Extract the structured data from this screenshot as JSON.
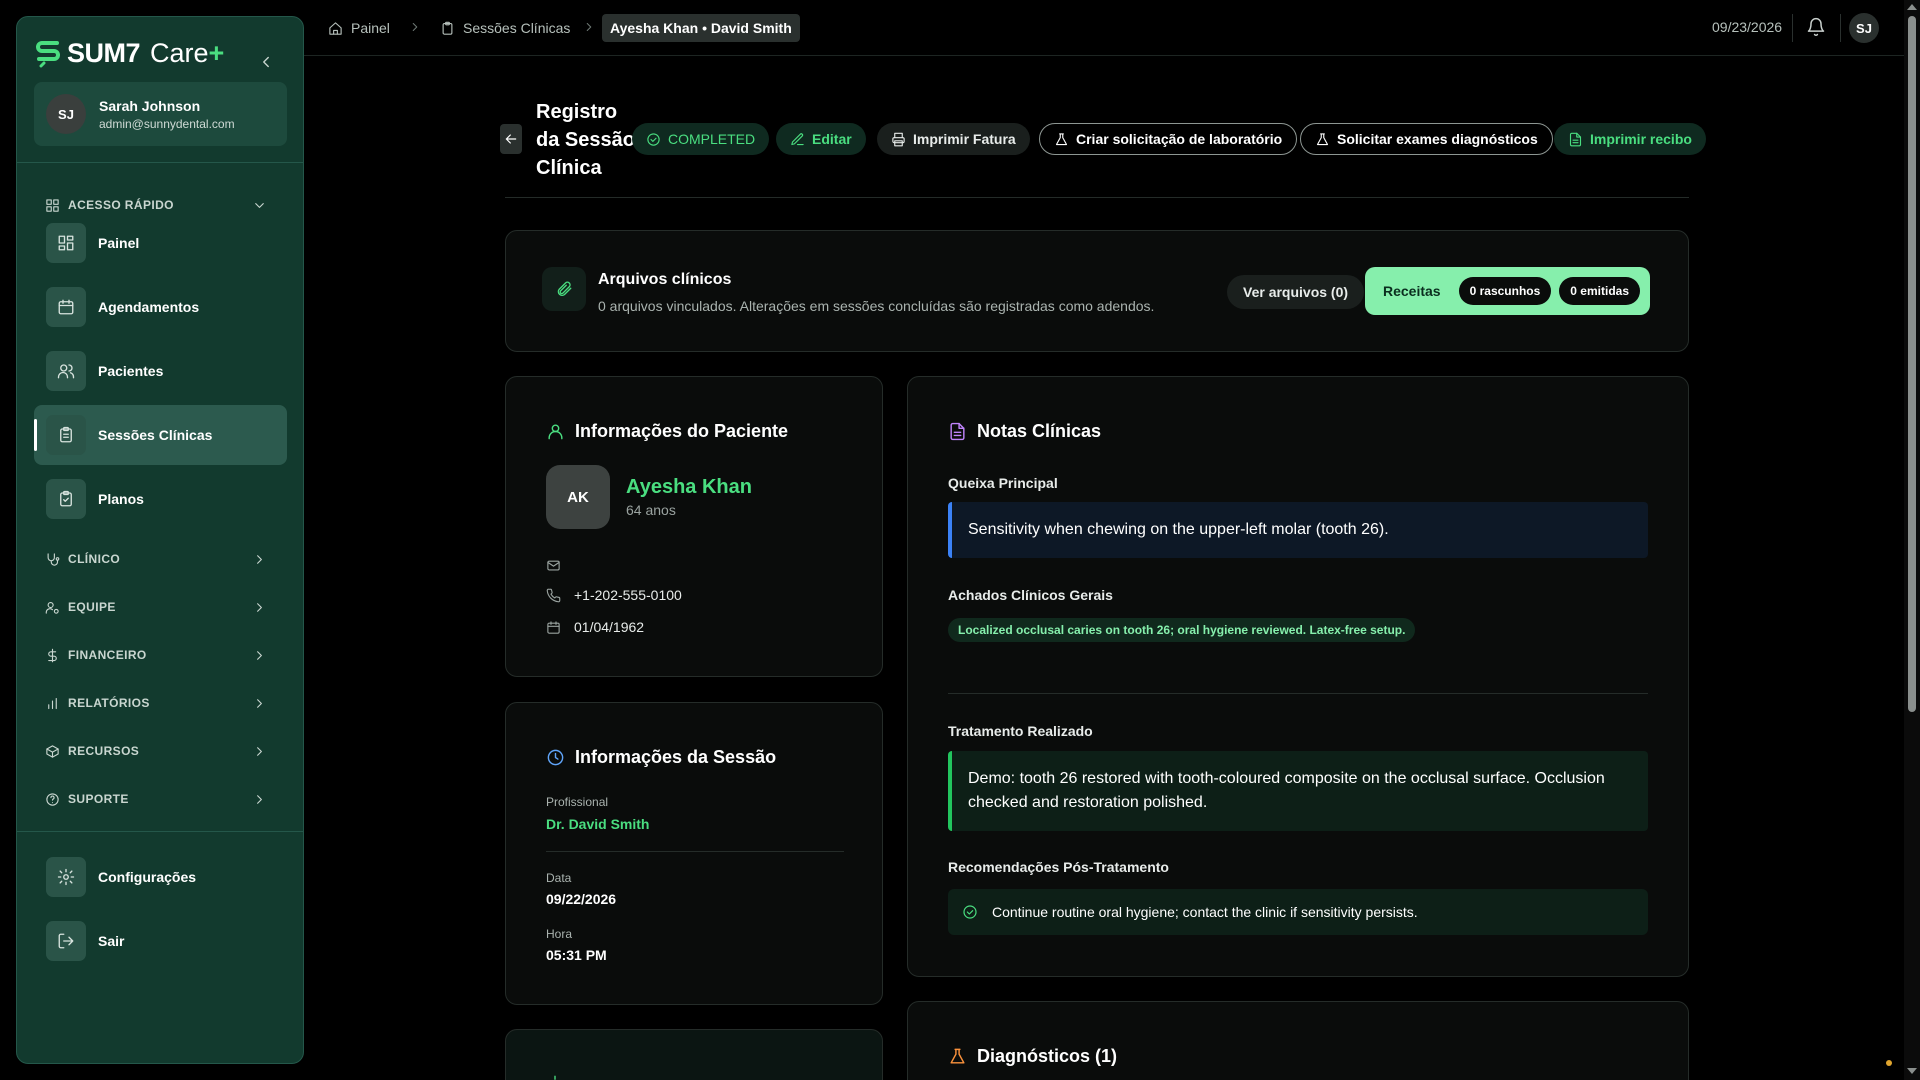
{
  "brand": {
    "name": "SUM7",
    "suffix": "Care",
    "plus": "+"
  },
  "user": {
    "initials": "SJ",
    "name": "Sarah Johnson",
    "email": "admin@sunnydental.com"
  },
  "sidebar": {
    "quick_access_label": "ACESSO RÁPIDO",
    "quick_items": [
      {
        "label": "Painel",
        "icon": "dashboard-grid-icon"
      },
      {
        "label": "Agendamentos",
        "icon": "calendar-icon"
      },
      {
        "label": "Pacientes",
        "icon": "users-icon"
      },
      {
        "label": "Sessões Clínicas",
        "icon": "clipboard-icon",
        "active": true
      },
      {
        "label": "Planos",
        "icon": "clipboard-check-icon"
      }
    ],
    "sections": [
      {
        "label": "CLÍNICO",
        "icon": "stethoscope-icon"
      },
      {
        "label": "EQUIPE",
        "icon": "user-cog-icon"
      },
      {
        "label": "FINANCEIRO",
        "icon": "dollar-icon"
      },
      {
        "label": "RELATÓRIOS",
        "icon": "bar-chart-icon"
      },
      {
        "label": "RECURSOS",
        "icon": "package-icon"
      },
      {
        "label": "SUPORTE",
        "icon": "help-circle-icon"
      }
    ],
    "bottom_items": [
      {
        "label": "Configurações",
        "icon": "gear-icon"
      },
      {
        "label": "Sair",
        "icon": "logout-icon"
      }
    ]
  },
  "breadcrumb": {
    "items": [
      "Painel",
      "Sessões Clínicas"
    ],
    "current": "Ayesha Khan • David Smith"
  },
  "topbar": {
    "date": "09/23/2026",
    "avatar_initials": "SJ"
  },
  "header": {
    "title": "Registro da Sessão Clínica",
    "status": "COMPLETED",
    "actions": {
      "edit": "Editar",
      "print_invoice": "Imprimir Fatura",
      "lab_request": "Criar solicitação de laboratório",
      "diagnostics": "Solicitar exames diagnósticos",
      "print_receipt": "Imprimir recibo"
    }
  },
  "files": {
    "title": "Arquivos clínicos",
    "subtitle": "0 arquivos vinculados. Alterações em sessões concluídas são registradas como adendos.",
    "view_button": "Ver arquivos (0)",
    "prescriptions_label": "Receitas",
    "drafts": "0 rascunhos",
    "issued": "0 emitidas"
  },
  "patient": {
    "section_title": "Informações do Paciente",
    "initials": "AK",
    "name": "Ayesha Khan",
    "age": "64 anos",
    "email": "",
    "phone": "+1-202-555-0100",
    "birth_date": "01/04/1962"
  },
  "session": {
    "section_title": "Informações da Sessão",
    "professional_label": "Profissional",
    "professional": "Dr. David Smith",
    "date_label": "Data",
    "date": "09/22/2026",
    "time_label": "Hora",
    "time": "05:31 PM"
  },
  "notes": {
    "section_title": "Notas Clínicas",
    "chief_complaint_label": "Queixa Principal",
    "chief_complaint": "Sensitivity when chewing on the upper-left molar (tooth 26).",
    "findings_label": "Achados Clínicos Gerais",
    "findings": "Localized occlusal caries on tooth 26; oral hygiene reviewed. Latex-free setup.",
    "treatment_label": "Tratamento Realizado",
    "treatment": "Demo: tooth 26 restored with tooth-coloured composite on the occlusal surface. Occlusion checked and restoration polished.",
    "recommendations_label": "Recomendações Pós-Tratamento",
    "recommendation": "Continue routine oral hygiene; contact the clinic if sensitivity persists."
  },
  "diagnostics": {
    "section_title": "Diagnósticos (1)"
  },
  "colors": {
    "accent": "#4ade80",
    "sidebar_bg": "#123a2e",
    "page_bg": "#000000",
    "complaint_border": "#3b82f6",
    "treatment_border": "#22c55e",
    "prescription_bg": "#86efac"
  }
}
